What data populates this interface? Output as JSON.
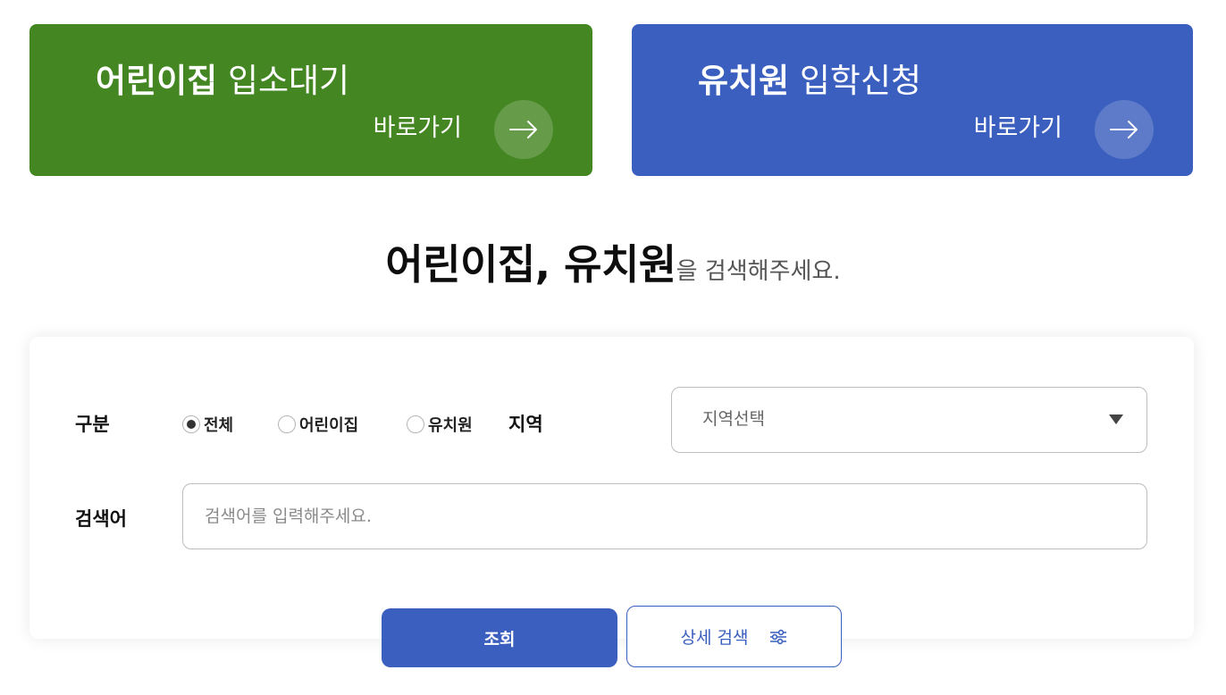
{
  "banners": {
    "daycare": {
      "title_bold": "어린이집",
      "title_light": "입소대기",
      "link_label": "바로가기",
      "icon": "arrow-right-icon",
      "color": "#448622"
    },
    "kindergarten": {
      "title_bold": "유치원",
      "title_light": "입학신청",
      "link_label": "바로가기",
      "icon": "arrow-right-icon",
      "color": "#3a5fbe"
    }
  },
  "heading": {
    "bold": "어린이집, 유치원",
    "rest": "을 검색해주세요."
  },
  "search_form": {
    "category_label": "구분",
    "category_options": [
      {
        "label": "전체",
        "checked": true
      },
      {
        "label": "어린이집",
        "checked": false
      },
      {
        "label": "유치원",
        "checked": false
      }
    ],
    "region_label": "지역",
    "region_select": {
      "value": "지역선택",
      "icon": "caret-down-icon"
    },
    "keyword_label": "검색어",
    "keyword_input": {
      "value": "",
      "placeholder": "검색어를 입력해주세요."
    }
  },
  "buttons": {
    "search_label": "조회",
    "detail_search_label": "상세 검색",
    "detail_search_icon": "filter-sliders-icon",
    "accent": "#3a5fbe"
  }
}
